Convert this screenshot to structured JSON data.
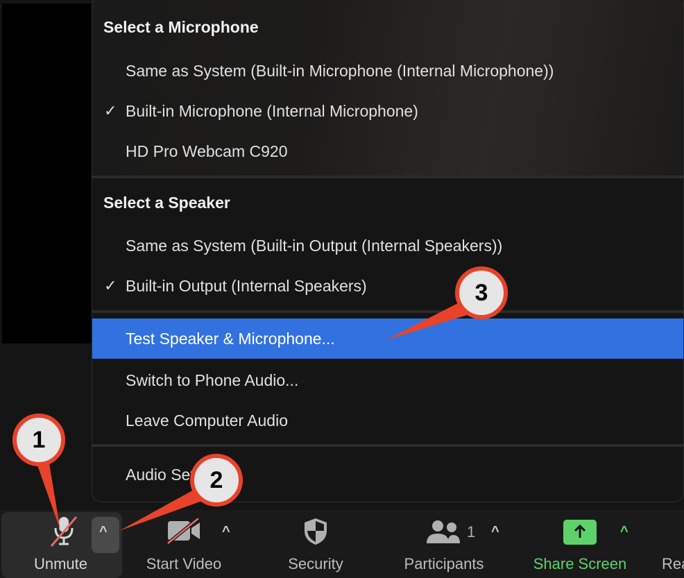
{
  "menu": {
    "microphone_heading": "Select a Microphone",
    "microphones": [
      {
        "label": "Same as System (Built-in Microphone (Internal Microphone))",
        "checked": false
      },
      {
        "label": "Built-in Microphone (Internal Microphone)",
        "checked": true
      },
      {
        "label": "HD Pro Webcam C920",
        "checked": false
      }
    ],
    "speaker_heading": "Select a Speaker",
    "speakers": [
      {
        "label": "Same as System (Built-in Output (Internal Speakers))",
        "checked": false
      },
      {
        "label": "Built-in Output (Internal Speakers)",
        "checked": true
      }
    ],
    "actions": [
      {
        "label": "Test Speaker & Microphone...",
        "highlighted": true
      },
      {
        "label": "Switch to Phone Audio...",
        "highlighted": false
      },
      {
        "label": "Leave Computer Audio",
        "highlighted": false
      }
    ],
    "settings_label": "Audio Settings...",
    "check_glyph": "✓",
    "highlight_color": "#3272e0"
  },
  "toolbar": {
    "unmute_label": "Unmute",
    "start_video_label": "Start Video",
    "security_label": "Security",
    "participants_label": "Participants",
    "participants_count": "1",
    "share_screen_label": "Share Screen",
    "reactions_label_partial": "Rea",
    "caret_glyph": "^",
    "share_color": "#5ed26a"
  },
  "annotations": {
    "callout_1": "1",
    "callout_2": "2",
    "callout_3": "3",
    "callout_color": "#e8432a"
  }
}
